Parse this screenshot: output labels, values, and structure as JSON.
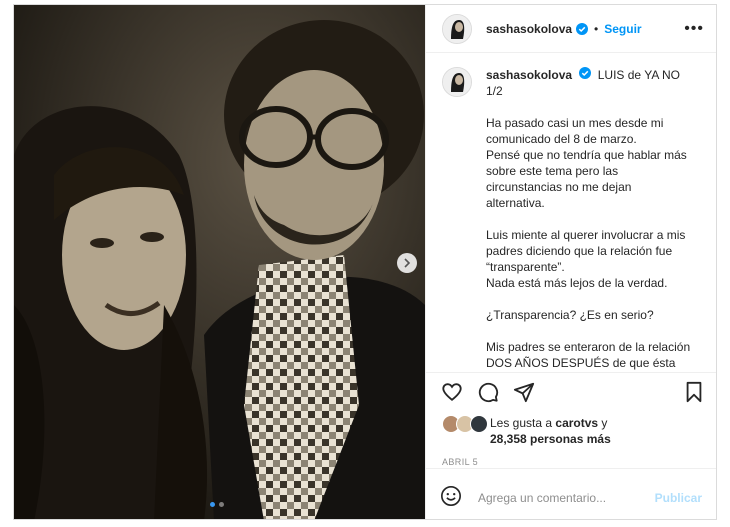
{
  "post": {
    "username": "sashasokolova",
    "follow_label": "Seguir",
    "more_icon": "ellipsis-icon",
    "verified_color": "#0095f6",
    "caption": {
      "username": "sashasokolova",
      "title": "LUIS de YA NO",
      "counter": "1/2",
      "paragraphs": [
        [
          "Ha pasado casi un mes desde mi",
          "comunicado del 8 de marzo.",
          "Pensé que no tendría que hablar más",
          "sobre este tema pero las",
          "circunstancias no me dejan",
          "alternativa."
        ],
        [
          "Luis miente al querer involucrar a mis",
          "padres diciendo que la relación fue",
          "“transparente”.",
          "Nada está más lejos de la verdad."
        ],
        [
          "¿Transparencia? ¿Es en serio?"
        ],
        [
          "Mis padres se enteraron de la relación",
          "DOS AÑOS DESPUÉS de que ésta"
        ]
      ]
    },
    "likes": {
      "prefix": "Les gusta a ",
      "user": "carotvs",
      "connector": " y",
      "count": "28,358 personas más"
    },
    "date": "ABRIL 5",
    "comment_placeholder": "Agrega un comentario...",
    "publish_label": "Publicar",
    "carousel": {
      "total": 2,
      "current": 1
    }
  }
}
